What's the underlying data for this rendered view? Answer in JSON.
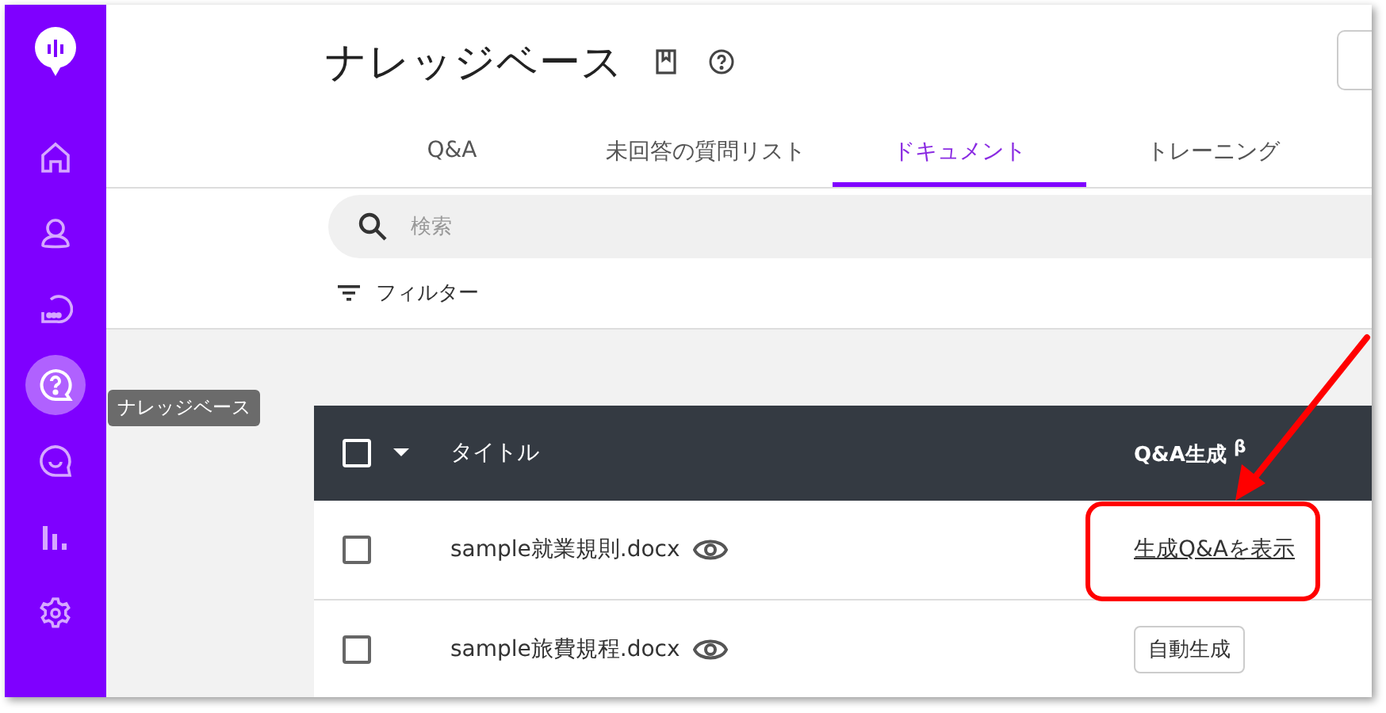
{
  "sidebar": {
    "items": [
      {
        "selected": false
      },
      {
        "selected": false
      },
      {
        "selected": false
      },
      {
        "selected": true
      },
      {
        "selected": false
      },
      {
        "selected": false
      },
      {
        "selected": false
      }
    ],
    "tooltip": "ナレッジベース"
  },
  "header": {
    "title": "ナレッジベース"
  },
  "tabs": [
    {
      "label": "Q&A",
      "selected": false
    },
    {
      "label": "未回答の質問リスト",
      "selected": false
    },
    {
      "label": "ドキュメント",
      "selected": true
    },
    {
      "label": "トレーニング",
      "selected": false
    }
  ],
  "search": {
    "placeholder": "検索"
  },
  "filter": {
    "label": "フィルター"
  },
  "table": {
    "header_checked": false,
    "columns": [
      "タイトル",
      "Q&A生成 $^{β}$"
    ],
    "rows": [
      {
        "checked": false,
        "title": "sample就業規則.docx",
        "action": {
          "kind": "link",
          "label": "生成Q&Aを表示"
        }
      },
      {
        "checked": false,
        "title": "sample旅費規程.docx",
        "action": {
          "kind": "button",
          "label": "自動生成"
        }
      }
    ]
  }
}
